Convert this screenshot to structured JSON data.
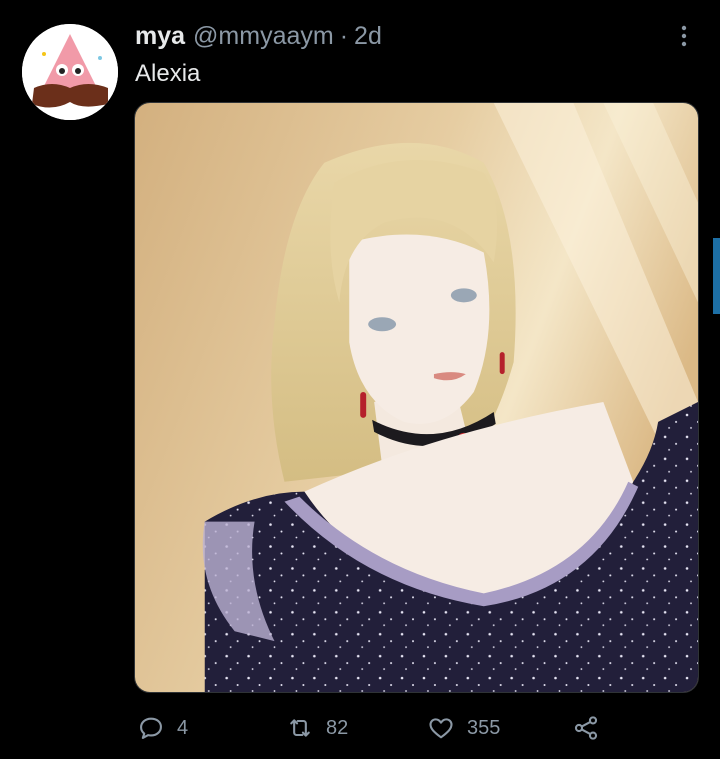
{
  "tweet": {
    "author_name": "mya",
    "author_handle": "@mmyaaym",
    "separator": "·",
    "time": "2d",
    "text": "Alexia"
  },
  "icons": {
    "more": "more-vertical-icon",
    "reply": "reply-icon",
    "retweet": "retweet-icon",
    "like": "heart-icon",
    "share": "share-icon"
  },
  "actions": {
    "reply_count": "4",
    "retweet_count": "82",
    "like_count": "355"
  },
  "colors": {
    "background": "#000000",
    "text_primary": "#e7e9ea",
    "text_secondary": "#8b98a5",
    "edge_accent": "#1d6fa5"
  }
}
